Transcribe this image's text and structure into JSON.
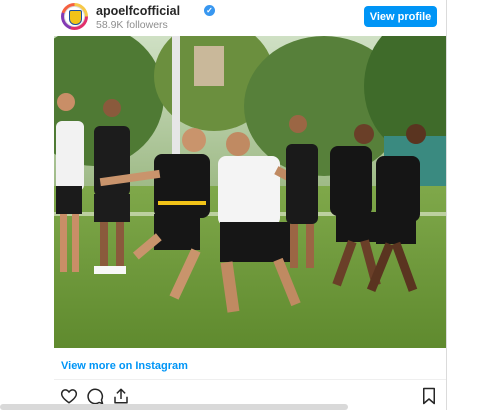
{
  "account": {
    "username": "apoelfcofficial",
    "followers": "58.9K followers",
    "verified_glyph": "✓"
  },
  "header": {
    "view_profile_label": "View profile"
  },
  "post": {
    "image_description_alt": "",
    "view_more_label": "View more on Instagram"
  },
  "actions": {
    "icons": [
      "heart-icon",
      "comment-icon",
      "share-icon",
      "bookmark-icon"
    ]
  },
  "colors": {
    "accent": "#0095f6",
    "text": "#262626",
    "muted": "#8e8e8e",
    "border": "#dbdbdb"
  }
}
